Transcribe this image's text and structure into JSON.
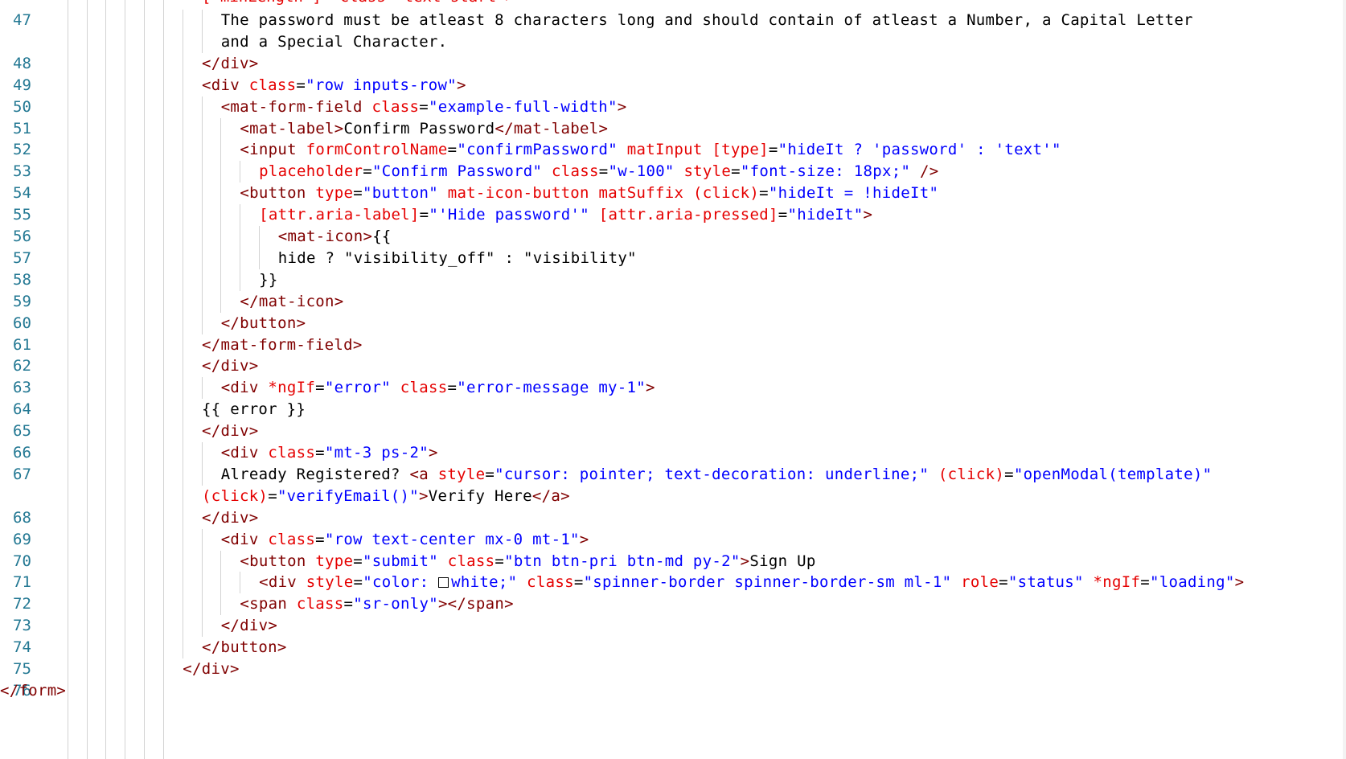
{
  "editor": {
    "top_partial_text": "[ minLength ]  class= text-start >",
    "lines": [
      {
        "number": "47",
        "segments": [
          {
            "c": "x",
            "t": "The password must be atleast 8 characters long and should contain of atleast a Number, a Capital Letter"
          }
        ]
      },
      {
        "number": "",
        "segments": [
          {
            "c": "x",
            "t": "and a Special Character."
          }
        ]
      },
      {
        "number": "48",
        "segments": [
          {
            "c": "t",
            "t": "</div>"
          }
        ]
      },
      {
        "number": "49",
        "segments": [
          {
            "c": "t",
            "t": "<div "
          },
          {
            "c": "a",
            "t": "class"
          },
          {
            "c": "x",
            "t": "="
          },
          {
            "c": "s",
            "t": "\"row inputs-row\""
          },
          {
            "c": "t",
            "t": ">"
          }
        ]
      },
      {
        "number": "50",
        "segments": [
          {
            "c": "t",
            "t": "<mat-form-field "
          },
          {
            "c": "a",
            "t": "class"
          },
          {
            "c": "x",
            "t": "="
          },
          {
            "c": "s",
            "t": "\"example-full-width\""
          },
          {
            "c": "t",
            "t": ">"
          }
        ]
      },
      {
        "number": "51",
        "segments": [
          {
            "c": "t",
            "t": "<mat-label>"
          },
          {
            "c": "x",
            "t": "Confirm Password"
          },
          {
            "c": "t",
            "t": "</mat-label>"
          }
        ]
      },
      {
        "number": "52",
        "segments": [
          {
            "c": "t",
            "t": "<input "
          },
          {
            "c": "a",
            "t": "formControlName"
          },
          {
            "c": "x",
            "t": "="
          },
          {
            "c": "s",
            "t": "\"confirmPassword\""
          },
          {
            "c": "x",
            "t": " "
          },
          {
            "c": "a",
            "t": "matInput"
          },
          {
            "c": "x",
            "t": " "
          },
          {
            "c": "a",
            "t": "[type]"
          },
          {
            "c": "x",
            "t": "="
          },
          {
            "c": "s",
            "t": "\"hideIt ? 'password' : 'text'\""
          }
        ]
      },
      {
        "number": "53",
        "segments": [
          {
            "c": "a",
            "t": "placeholder"
          },
          {
            "c": "x",
            "t": "="
          },
          {
            "c": "s",
            "t": "\"Confirm Password\""
          },
          {
            "c": "x",
            "t": " "
          },
          {
            "c": "a",
            "t": "class"
          },
          {
            "c": "x",
            "t": "="
          },
          {
            "c": "s",
            "t": "\"w-100\""
          },
          {
            "c": "x",
            "t": " "
          },
          {
            "c": "a",
            "t": "style"
          },
          {
            "c": "x",
            "t": "="
          },
          {
            "c": "s",
            "t": "\"font-size: 18px;\""
          },
          {
            "c": "x",
            "t": " "
          },
          {
            "c": "t",
            "t": "/>"
          }
        ]
      },
      {
        "number": "54",
        "segments": [
          {
            "c": "t",
            "t": "<button "
          },
          {
            "c": "a",
            "t": "type"
          },
          {
            "c": "x",
            "t": "="
          },
          {
            "c": "s",
            "t": "\"button\""
          },
          {
            "c": "x",
            "t": " "
          },
          {
            "c": "a",
            "t": "mat-icon-button"
          },
          {
            "c": "x",
            "t": " "
          },
          {
            "c": "a",
            "t": "matSuffix"
          },
          {
            "c": "x",
            "t": " "
          },
          {
            "c": "a",
            "t": "(click)"
          },
          {
            "c": "x",
            "t": "="
          },
          {
            "c": "s",
            "t": "\"hideIt = !hideIt\""
          }
        ]
      },
      {
        "number": "55",
        "segments": [
          {
            "c": "a",
            "t": "[attr.aria-label]"
          },
          {
            "c": "x",
            "t": "="
          },
          {
            "c": "s",
            "t": "\"'Hide password'\""
          },
          {
            "c": "x",
            "t": " "
          },
          {
            "c": "a",
            "t": "[attr.aria-pressed]"
          },
          {
            "c": "x",
            "t": "="
          },
          {
            "c": "s",
            "t": "\"hideIt\""
          },
          {
            "c": "t",
            "t": ">"
          }
        ]
      },
      {
        "number": "56",
        "segments": [
          {
            "c": "t",
            "t": "<mat-icon>"
          },
          {
            "c": "x",
            "t": "{{"
          }
        ]
      },
      {
        "number": "57",
        "segments": [
          {
            "c": "x",
            "t": "hide ? \"visibility_off\" : \"visibility\""
          }
        ]
      },
      {
        "number": "58",
        "segments": [
          {
            "c": "x",
            "t": "}}"
          }
        ]
      },
      {
        "number": "59",
        "segments": [
          {
            "c": "t",
            "t": "</mat-icon>"
          }
        ]
      },
      {
        "number": "60",
        "segments": [
          {
            "c": "t",
            "t": "</button>"
          }
        ]
      },
      {
        "number": "61",
        "segments": [
          {
            "c": "t",
            "t": "</mat-form-field>"
          }
        ]
      },
      {
        "number": "62",
        "segments": [
          {
            "c": "t",
            "t": "</div>"
          }
        ]
      },
      {
        "number": "63",
        "segments": [
          {
            "c": "t",
            "t": "<div "
          },
          {
            "c": "a",
            "t": "*ngIf"
          },
          {
            "c": "x",
            "t": "="
          },
          {
            "c": "s",
            "t": "\"error\""
          },
          {
            "c": "x",
            "t": " "
          },
          {
            "c": "a",
            "t": "class"
          },
          {
            "c": "x",
            "t": "="
          },
          {
            "c": "s",
            "t": "\"error-message my-1\""
          },
          {
            "c": "t",
            "t": ">"
          }
        ]
      },
      {
        "number": "64",
        "segments": [
          {
            "c": "x",
            "t": "{{ error }}"
          }
        ]
      },
      {
        "number": "65",
        "segments": [
          {
            "c": "t",
            "t": "</div>"
          }
        ]
      },
      {
        "number": "66",
        "segments": [
          {
            "c": "t",
            "t": "<div "
          },
          {
            "c": "a",
            "t": "class"
          },
          {
            "c": "x",
            "t": "="
          },
          {
            "c": "s",
            "t": "\"mt-3 ps-2\""
          },
          {
            "c": "t",
            "t": ">"
          }
        ]
      },
      {
        "number": "67",
        "segments": [
          {
            "c": "x",
            "t": "Already Registered? "
          },
          {
            "c": "t",
            "t": "<a "
          },
          {
            "c": "a",
            "t": "style"
          },
          {
            "c": "x",
            "t": "="
          },
          {
            "c": "s",
            "t": "\"cursor: pointer; text-decoration: underline;\""
          },
          {
            "c": "x",
            "t": " "
          },
          {
            "c": "a",
            "t": "(click)"
          },
          {
            "c": "x",
            "t": "="
          },
          {
            "c": "s",
            "t": "\"openModal(template)\""
          }
        ]
      },
      {
        "number": "",
        "segments": [
          {
            "c": "a",
            "t": "(click)"
          },
          {
            "c": "x",
            "t": "="
          },
          {
            "c": "s",
            "t": "\"verifyEmail()\""
          },
          {
            "c": "t",
            "t": ">"
          },
          {
            "c": "x",
            "t": "Verify Here"
          },
          {
            "c": "t",
            "t": "</a>"
          }
        ]
      },
      {
        "number": "68",
        "segments": [
          {
            "c": "t",
            "t": "</div>"
          }
        ]
      },
      {
        "number": "69",
        "segments": [
          {
            "c": "t",
            "t": "<div "
          },
          {
            "c": "a",
            "t": "class"
          },
          {
            "c": "x",
            "t": "="
          },
          {
            "c": "s",
            "t": "\"row text-center mx-0 mt-1\""
          },
          {
            "c": "t",
            "t": ">"
          }
        ]
      },
      {
        "number": "70",
        "segments": [
          {
            "c": "t",
            "t": "<button "
          },
          {
            "c": "a",
            "t": "type"
          },
          {
            "c": "x",
            "t": "="
          },
          {
            "c": "s",
            "t": "\"submit\""
          },
          {
            "c": "x",
            "t": " "
          },
          {
            "c": "a",
            "t": "class"
          },
          {
            "c": "x",
            "t": "="
          },
          {
            "c": "s",
            "t": "\"btn btn-pri btn-md py-2\""
          },
          {
            "c": "t",
            "t": ">"
          },
          {
            "c": "x",
            "t": "Sign Up"
          }
        ]
      },
      {
        "number": "71",
        "segments": [
          {
            "c": "t",
            "t": "<div "
          },
          {
            "c": "a",
            "t": "style"
          },
          {
            "c": "x",
            "t": "="
          },
          {
            "c": "s",
            "t": "\"color: "
          },
          {
            "c": "swatch",
            "t": ""
          },
          {
            "c": "s",
            "t": "white;\""
          },
          {
            "c": "x",
            "t": " "
          },
          {
            "c": "a",
            "t": "class"
          },
          {
            "c": "x",
            "t": "="
          },
          {
            "c": "s",
            "t": "\"spinner-border spinner-border-sm ml-1\""
          },
          {
            "c": "x",
            "t": " "
          },
          {
            "c": "a",
            "t": "role"
          },
          {
            "c": "x",
            "t": "="
          },
          {
            "c": "s",
            "t": "\"status\""
          },
          {
            "c": "x",
            "t": " "
          },
          {
            "c": "a",
            "t": "*ngIf"
          },
          {
            "c": "x",
            "t": "="
          },
          {
            "c": "s",
            "t": "\"loading\""
          },
          {
            "c": "t",
            "t": ">"
          }
        ]
      },
      {
        "number": "72",
        "segments": [
          {
            "c": "t",
            "t": "<span "
          },
          {
            "c": "a",
            "t": "class"
          },
          {
            "c": "x",
            "t": "="
          },
          {
            "c": "s",
            "t": "\"sr-only\""
          },
          {
            "c": "t",
            "t": "></span>"
          }
        ]
      },
      {
        "number": "73",
        "segments": [
          {
            "c": "t",
            "t": "</div>"
          }
        ]
      },
      {
        "number": "74",
        "segments": [
          {
            "c": "t",
            "t": "</button>"
          }
        ]
      },
      {
        "number": "75",
        "segments": [
          {
            "c": "t",
            "t": "</div>"
          }
        ]
      },
      {
        "number": "76",
        "segments": [
          {
            "c": "t",
            "t": "</form>"
          }
        ]
      }
    ],
    "colors": {
      "line_number": "#237893",
      "tag": "#800000",
      "attribute": "#e50000",
      "string": "#0000ff",
      "text": "#000000",
      "indent_guide": "#d3d3d3",
      "background": "#ffffff"
    }
  }
}
